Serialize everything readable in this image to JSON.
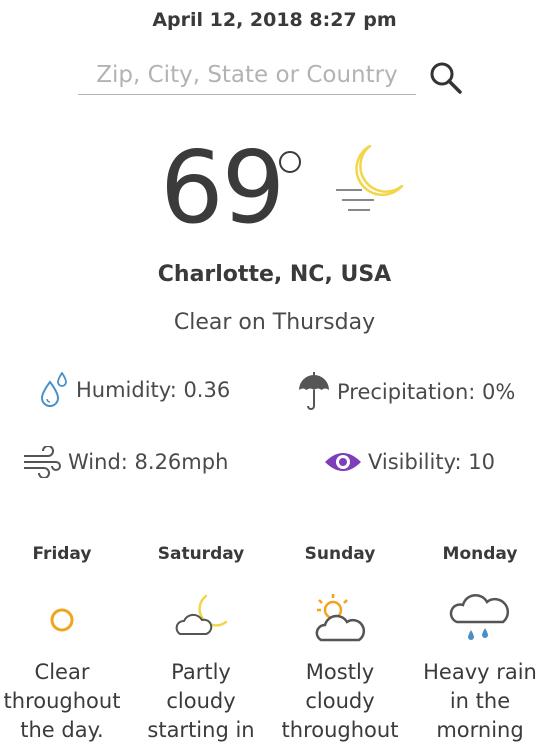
{
  "header": {
    "datetime": "April 12, 2018 8:27 pm"
  },
  "search": {
    "placeholder": "Zip, City, State or Country",
    "value": ""
  },
  "current": {
    "temperature": "69",
    "location": "Charlotte, NC, USA",
    "summary": "Clear on Thursday",
    "icon": "moon-night-icon"
  },
  "stats": {
    "humidity": "Humidity: 0.36",
    "precipitation": "Precipitation: 0%",
    "wind": "Wind: 8.26mph",
    "visibility": "Visibility: 10"
  },
  "forecast": [
    {
      "day": "Friday",
      "icon": "sun-icon",
      "summary_lines": [
        "Clear",
        "throughout",
        "the day."
      ]
    },
    {
      "day": "Saturday",
      "icon": "partly-cloudy-night-icon",
      "summary_lines": [
        "Partly",
        "cloudy",
        "starting in"
      ]
    },
    {
      "day": "Sunday",
      "icon": "partly-cloudy-day-icon",
      "summary_lines": [
        "Mostly",
        "cloudy",
        "throughout"
      ]
    },
    {
      "day": "Monday",
      "icon": "rain-icon",
      "summary_lines": [
        "Heavy rain",
        "in the",
        "morning"
      ]
    }
  ],
  "colors": {
    "accent_yellow": "#f2d64a",
    "sun_orange": "#f0a51c",
    "humidity_blue": "#4a90c8",
    "visibility_purple": "#7d3fb8",
    "icon_gray": "#555555"
  }
}
